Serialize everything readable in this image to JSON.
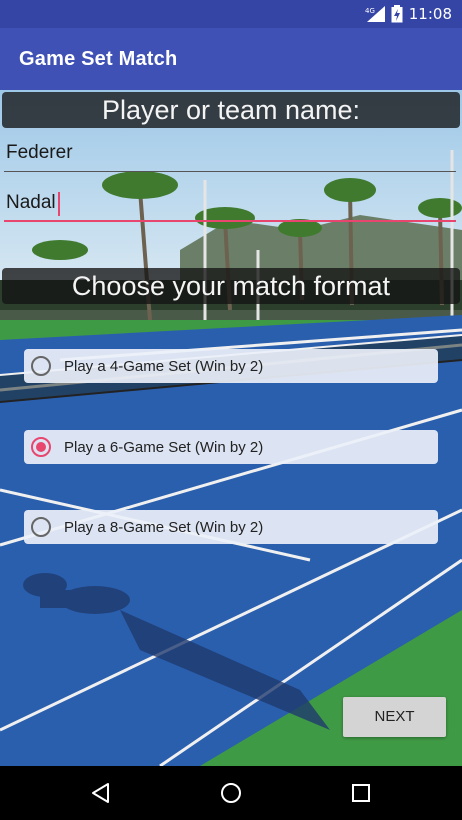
{
  "status_bar": {
    "time": "11:08",
    "network": "4G"
  },
  "app_bar": {
    "title": "Game Set Match"
  },
  "players": {
    "heading": "Player or team name:",
    "player1_value": "Federer",
    "player2_value": "Nadal"
  },
  "format": {
    "heading": "Choose your match format",
    "options": [
      {
        "label": "Play a 4-Game Set (Win by 2)",
        "selected": false
      },
      {
        "label": "Play a 6-Game Set (Win by 2)",
        "selected": true
      },
      {
        "label": "Play a 8-Game Set (Win by 2)",
        "selected": false
      }
    ]
  },
  "actions": {
    "next_label": "NEXT"
  },
  "nav_icons": [
    "back-icon",
    "home-icon",
    "recents-icon"
  ],
  "colors": {
    "primary": "#3f51b5",
    "status_bar": "#3545a5",
    "accent": "#e8466f"
  }
}
